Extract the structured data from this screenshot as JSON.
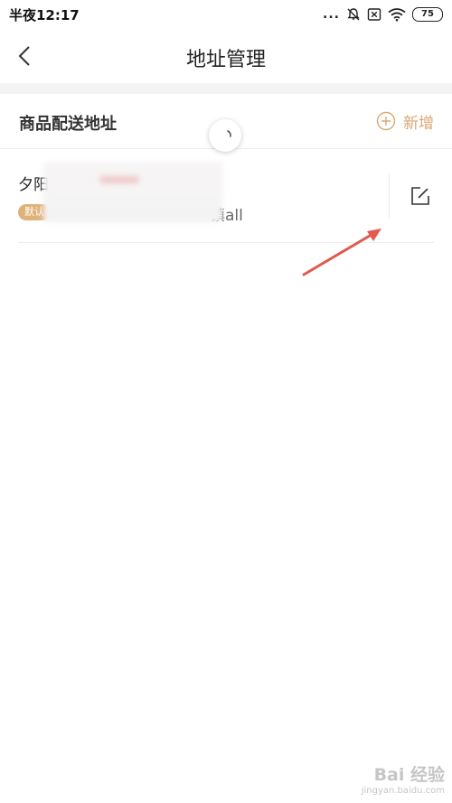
{
  "status_bar": {
    "time": "半夜12:17",
    "dots": "...",
    "battery": "75"
  },
  "header": {
    "title": "地址管理"
  },
  "section": {
    "title": "商品配送地址",
    "add_label": "新增"
  },
  "address": {
    "name": "夕阳",
    "badge": "默认",
    "detail_tail": "镇all"
  },
  "watermark": {
    "logo": "Bai 经验",
    "url": "jingyan.baidu.com"
  },
  "colors": {
    "accent": "#d9a872",
    "badge_bg": "#e0b27a",
    "arrow": "#e05a4f"
  }
}
